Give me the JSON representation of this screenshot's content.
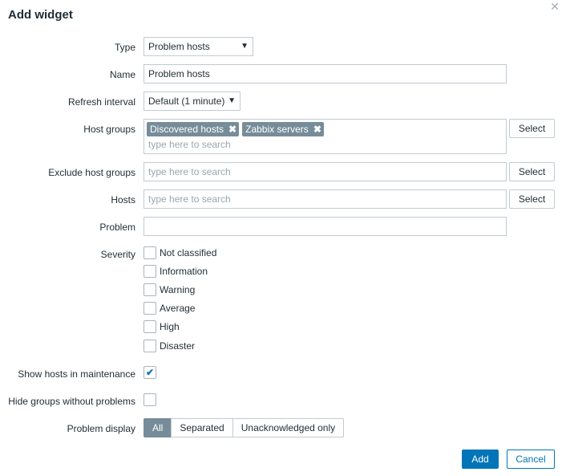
{
  "dialog": {
    "title": "Add widget",
    "close_icon": "close-icon"
  },
  "form": {
    "type": {
      "label": "Type",
      "value": "Problem hosts"
    },
    "name": {
      "label": "Name",
      "value": "Problem hosts"
    },
    "refresh_interval": {
      "label": "Refresh interval",
      "value": "Default (1 minute)"
    },
    "host_groups": {
      "label": "Host groups",
      "tags": [
        "Discovered hosts",
        "Zabbix servers"
      ],
      "placeholder": "type here to search",
      "select_label": "Select"
    },
    "exclude_host_groups": {
      "label": "Exclude host groups",
      "placeholder": "type here to search",
      "select_label": "Select"
    },
    "hosts": {
      "label": "Hosts",
      "placeholder": "type here to search",
      "select_label": "Select"
    },
    "problem": {
      "label": "Problem",
      "value": ""
    },
    "severity": {
      "label": "Severity",
      "options": [
        {
          "label": "Not classified",
          "checked": false
        },
        {
          "label": "Information",
          "checked": false
        },
        {
          "label": "Warning",
          "checked": false
        },
        {
          "label": "Average",
          "checked": false
        },
        {
          "label": "High",
          "checked": false
        },
        {
          "label": "Disaster",
          "checked": false
        }
      ]
    },
    "show_hosts_in_maintenance": {
      "label": "Show hosts in maintenance",
      "checked": true
    },
    "hide_groups_without_problems": {
      "label": "Hide groups without problems",
      "checked": false
    },
    "problem_display": {
      "label": "Problem display",
      "options": [
        "All",
        "Separated",
        "Unacknowledged only"
      ],
      "selected": "All"
    }
  },
  "footer": {
    "add_label": "Add",
    "cancel_label": "Cancel"
  },
  "colors": {
    "primary": "#0275b8",
    "tag_bg": "#768d99",
    "border": "#c2cbd1"
  }
}
